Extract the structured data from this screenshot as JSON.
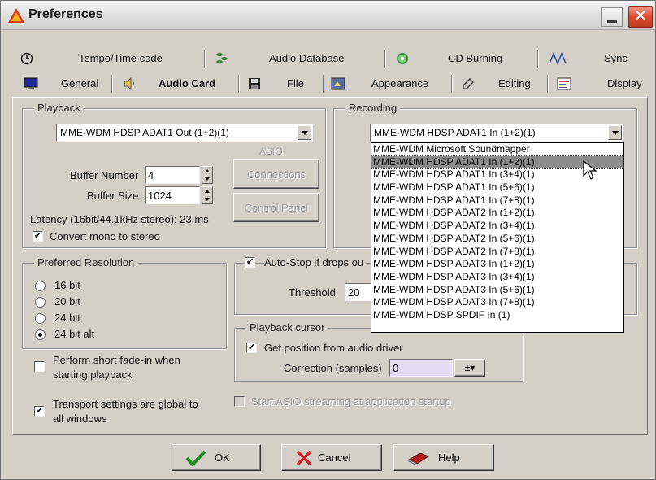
{
  "window": {
    "title": "Preferences"
  },
  "tabs_row1": [
    {
      "label": "Tempo/Time code",
      "icon": "clock-icon"
    },
    {
      "label": "Audio Database",
      "icon": "database-icon"
    },
    {
      "label": "CD Burning",
      "icon": "cd-icon"
    },
    {
      "label": "Sync",
      "icon": "sync-wave-icon"
    }
  ],
  "tabs_row2": [
    {
      "label": "General",
      "icon": "monitor-icon"
    },
    {
      "label": "Audio Card",
      "icon": "speaker-icon",
      "active": true
    },
    {
      "label": "File",
      "icon": "floppy-icon"
    },
    {
      "label": "Appearance",
      "icon": "appearance-icon"
    },
    {
      "label": "Editing",
      "icon": "editing-icon"
    },
    {
      "label": "Display",
      "icon": "display-icon"
    }
  ],
  "playback": {
    "legend": "Playback",
    "device": "MME-WDM HDSP ADAT1 Out (1+2)(1)",
    "asio_label": "ASIO",
    "connections_label": "Connections",
    "control_panel_label": "Control Panel",
    "buffer_number_label": "Buffer Number",
    "buffer_number": "4",
    "buffer_size_label": "Buffer Size",
    "buffer_size": "1024",
    "latency": "Latency (16bit/44.1kHz stereo): 23 ms",
    "convert_mono_label": "Convert mono to stereo",
    "convert_mono_checked": true
  },
  "recording": {
    "legend": "Recording",
    "device": "MME-WDM HDSP ADAT1 In (1+2)(1)",
    "options": [
      "MME-WDM Microsoft Soundmapper",
      "MME-WDM HDSP ADAT1 In (1+2)(1)",
      "MME-WDM HDSP ADAT1 In (3+4)(1)",
      "MME-WDM HDSP ADAT1 In (5+6)(1)",
      "MME-WDM HDSP ADAT1 In (7+8)(1)",
      "MME-WDM HDSP ADAT2 In (1+2)(1)",
      "MME-WDM HDSP ADAT2 In (3+4)(1)",
      "MME-WDM HDSP ADAT2 In (5+6)(1)",
      "MME-WDM HDSP ADAT2 In (7+8)(1)",
      "MME-WDM HDSP ADAT3 In (1+2)(1)",
      "MME-WDM HDSP ADAT3 In (3+4)(1)",
      "MME-WDM HDSP ADAT3 In (5+6)(1)",
      "MME-WDM HDSP ADAT3 In (7+8)(1)",
      "MME-WDM HDSP SPDIF In (1)"
    ],
    "selected_index": 1
  },
  "resolution": {
    "legend": "Preferred Resolution",
    "options": [
      "16 bit",
      "20 bit",
      "24 bit",
      "24 bit alt"
    ],
    "selected_index": 3
  },
  "autostop": {
    "label": "Auto-Stop if drops ou",
    "checked": true,
    "threshold_label": "Threshold",
    "threshold": "20"
  },
  "fade_in": {
    "label_line1": "Perform short fade-in when",
    "label_line2": "starting playback",
    "checked": false
  },
  "playback_cursor": {
    "legend": "Playback cursor",
    "get_position_label": "Get position from audio driver",
    "get_position_checked": true,
    "correction_label": "Correction (samples)",
    "correction": "0"
  },
  "transport": {
    "label_line1": "Transport settings are global to",
    "label_line2": "all windows",
    "checked": true
  },
  "asio_startup": {
    "label": "Start ASIO streaming at application startup",
    "checked": false
  },
  "buttons": {
    "ok": "OK",
    "cancel": "Cancel",
    "help": "Help"
  }
}
